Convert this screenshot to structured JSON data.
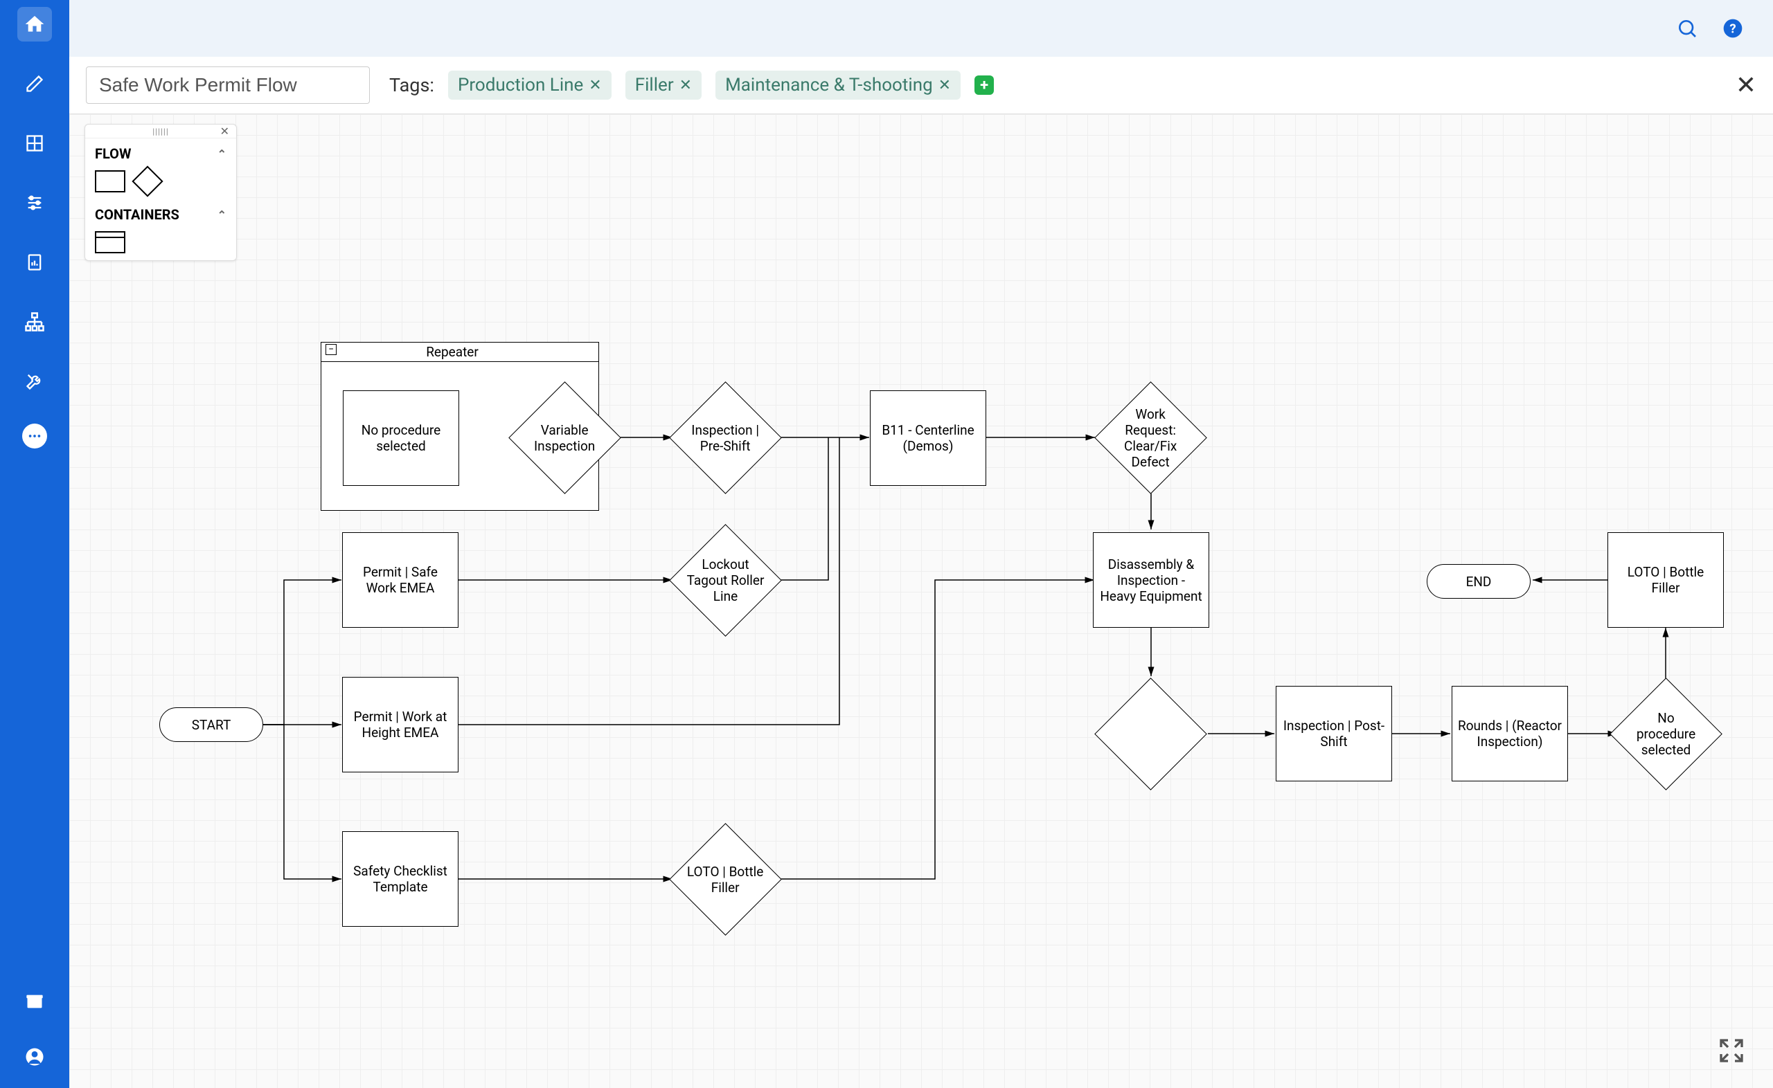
{
  "title": "Safe Work Permit Flow",
  "tags_label": "Tags:",
  "tags": [
    "Production Line",
    "Filler",
    "Maintenance & T-shooting"
  ],
  "shapes_panel": {
    "flow_label": "FLOW",
    "containers_label": "CONTAINERS"
  },
  "nodes": {
    "repeater_title": "Repeater",
    "no_proc_1": "No procedure selected",
    "var_insp": "Variable Inspection",
    "insp_preshift": "Inspection | Pre-Shift",
    "b11": "B11 - Centerline (Demos)",
    "work_req": "Work Request: Clear/Fix Defect",
    "permit_safe": "Permit | Safe Work EMEA",
    "loto_roller": "Lockout Tagout Roller Line",
    "dis_insp": "Disassembly & Inspection - Heavy Equipment",
    "end": "END",
    "loto_bottle2": "LOTO | Bottle Filler",
    "start": "START",
    "permit_height": "Permit | Work at Height EMEA",
    "safety_check": "Safety Checklist Template",
    "loto_bottle": "LOTO | Bottle Filler",
    "insp_postshift": "Inspection | Post-Shift",
    "rounds": "Rounds | (Reactor Inspection)",
    "no_proc_2": "No procedure selected"
  }
}
